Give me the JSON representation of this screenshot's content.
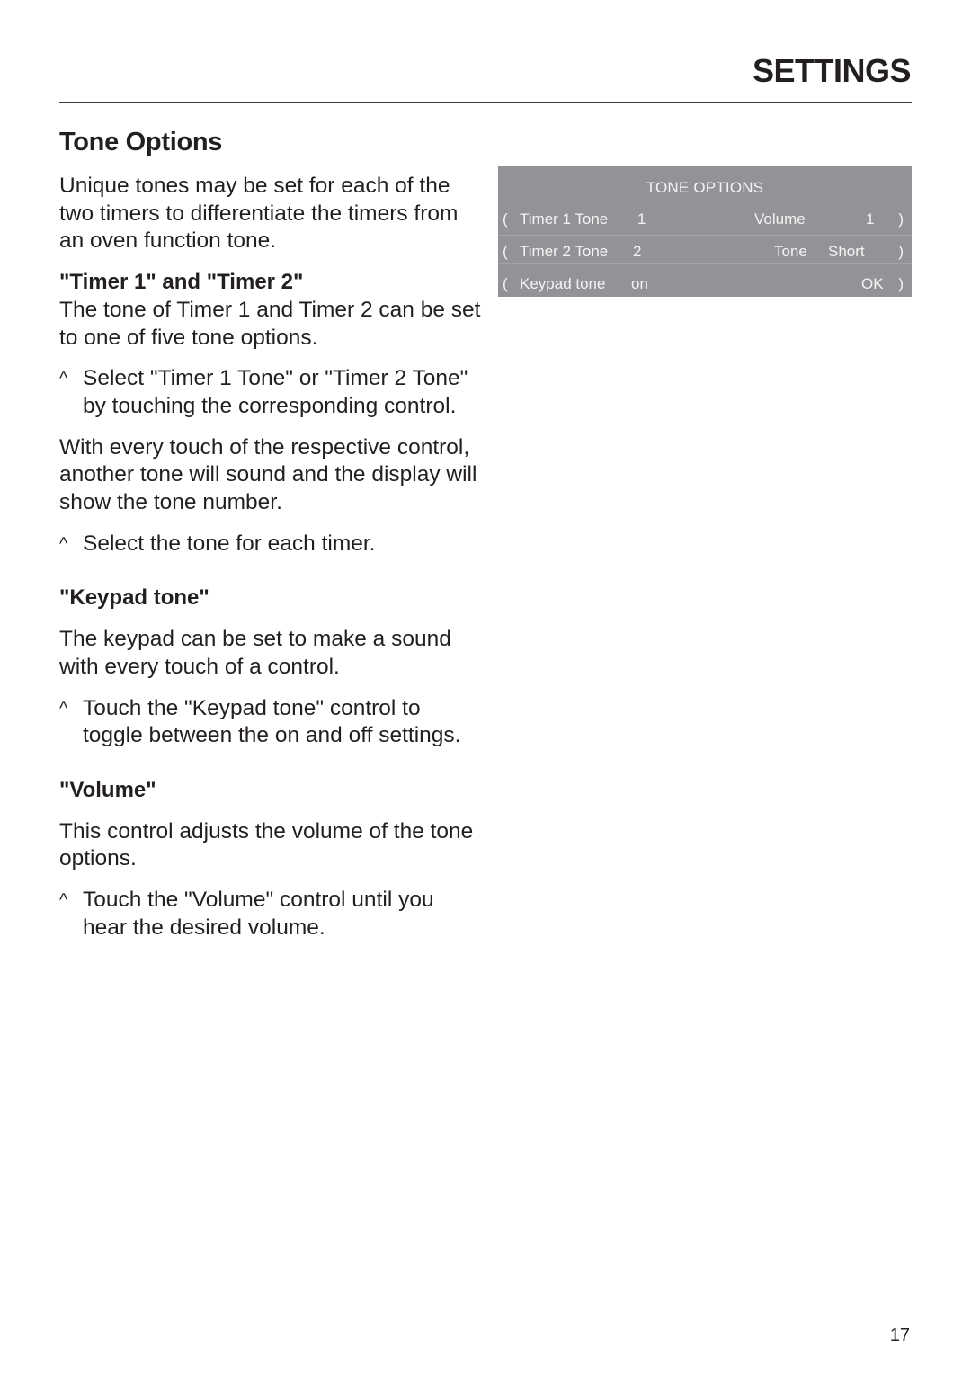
{
  "header": {
    "section_title": "SETTINGS"
  },
  "page": {
    "heading": "Tone Options",
    "page_number": "17"
  },
  "content": {
    "intro": "Unique tones may be set for each of the two timers to differentiate the timers from an oven function tone.",
    "timers": {
      "heading": "\"Timer 1\" and \"Timer 2\"",
      "text": "The tone of Timer 1 and Timer 2 can be set to one of five tone options.",
      "step1": "Select \"Timer 1 Tone\" or \"Timer 2 Tone\" by touching the corresponding control.",
      "text2": "With every touch of the respective control, another tone will sound and the display will show the tone number.",
      "step2": "Select the tone for each timer."
    },
    "keypad": {
      "heading": "\"Keypad tone\"",
      "text": "The keypad can be set to make a sound with every touch of a control.",
      "step": "Touch the \"Keypad tone\" control to toggle between the on and off settings."
    },
    "volume": {
      "heading": "\"Volume\"",
      "text": "This control adjusts the volume of the tone options.",
      "step": "Touch the \"Volume\" control until you hear the desired volume."
    },
    "step_marker": "^"
  },
  "display": {
    "title": "TONE OPTIONS",
    "colors": {
      "background": "#929396",
      "text": "#f4f4f4"
    },
    "rows": [
      {
        "left_bracket": "(",
        "left_label": "Timer 1 Tone",
        "left_value": "1",
        "right_label": "Volume",
        "right_value": "1",
        "right_bracket": ")"
      },
      {
        "left_bracket": "(",
        "left_label": "Timer 2 Tone",
        "left_value": "2",
        "right_label": "Tone",
        "right_value": "Short",
        "right_bracket": ")"
      },
      {
        "left_bracket": "(",
        "left_label": "Keypad tone",
        "left_value": "on",
        "right_label": "",
        "right_value": "OK",
        "right_bracket": ")"
      }
    ]
  }
}
